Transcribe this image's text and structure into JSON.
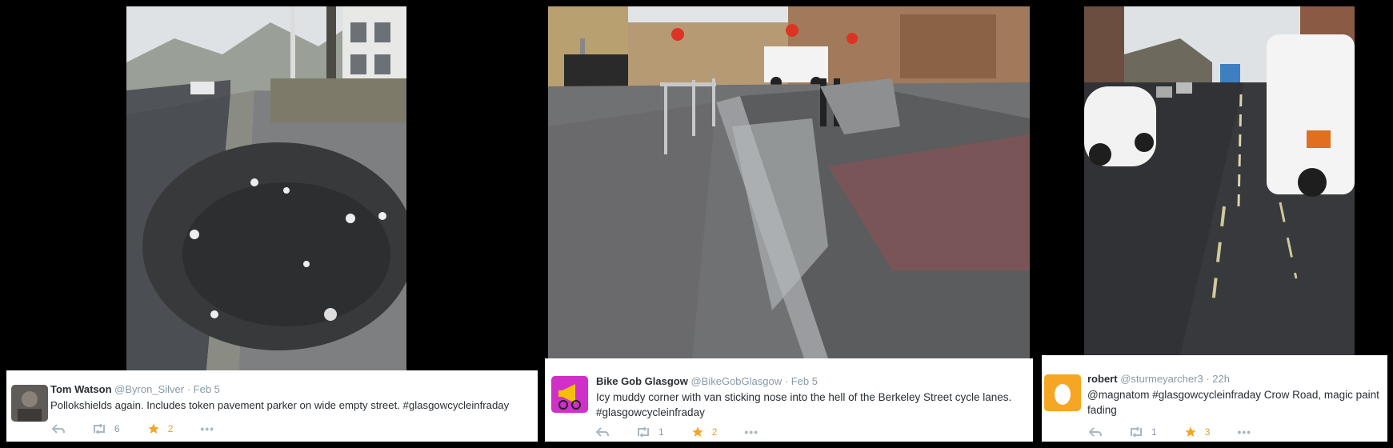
{
  "tweets": [
    {
      "name": "Tom Watson",
      "handle": "@Byron_Silver",
      "separator": "·",
      "time": "Feb 5",
      "text": "Pollokshields again. Includes token pavement parker on wide empty street. #glasgowcycleinfraday",
      "retweets": "6",
      "favorites": "2",
      "more": "•••",
      "avatar_icon": "person-photo-icon"
    },
    {
      "name": "Bike Gob Glasgow",
      "handle": "@BikeGobGlasgow",
      "separator": "·",
      "time": "Feb 5",
      "text": "Icy muddy corner with van sticking nose into the hell of the Berkeley Street cycle lanes. #glasgowcycleinfraday",
      "retweets": "1",
      "favorites": "2",
      "more": "•••",
      "avatar_icon": "megaphone-bike-icon"
    },
    {
      "name": "robert",
      "handle": "@sturmeyarcher3",
      "separator": "·",
      "time": "22h",
      "text": "@magnatom #glasgowcycleinfraday Crow Road, magic paint fading",
      "retweets": "1",
      "favorites": "3",
      "more": "•••",
      "avatar_icon": "egg-icon"
    }
  ],
  "colors": {
    "favorite_star": "#f5a623",
    "egg_avatar_bg": "#f5a623",
    "bikegob_avatar_bg": "#d030c8",
    "muted": "#8899a6"
  }
}
